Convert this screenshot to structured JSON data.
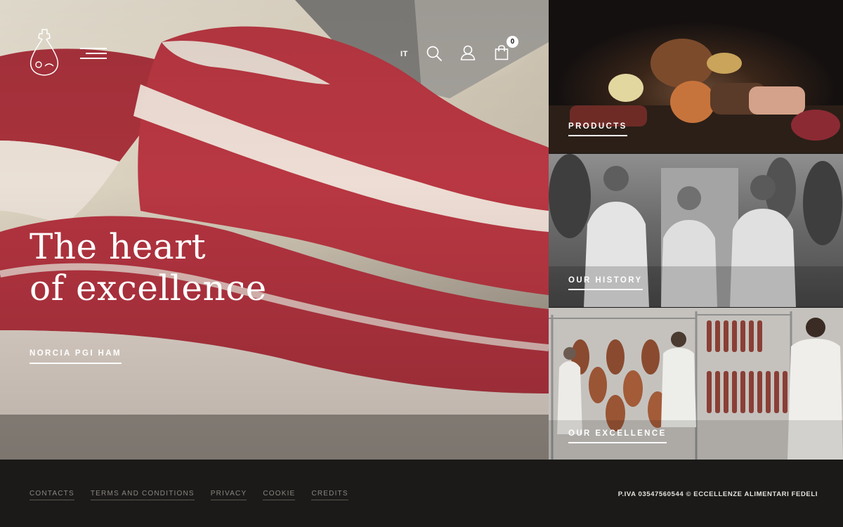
{
  "header": {
    "logo_icon": "ham-leg-icon",
    "menu_icon": "menu-icon",
    "language": "IT",
    "search_icon": "search-icon",
    "account_icon": "user-icon",
    "cart_icon": "shopping-bag-icon",
    "cart_count": "0"
  },
  "hero": {
    "title_line1": "The heart",
    "title_line2": "of excellence",
    "link_label": "NORCIA PGI HAM"
  },
  "panels": [
    {
      "label": "PRODUCTS"
    },
    {
      "label": "OUR HISTORY"
    },
    {
      "label": "OUR EXCELLENCE"
    }
  ],
  "footer": {
    "links": [
      "CONTACTS",
      "TERMS AND CONDITIONS",
      "PRIVACY",
      "COOKIE",
      "CREDITS"
    ],
    "copyright": "P.IVA 03547560544 © ECCELLENZE ALIMENTARI FEDELI"
  },
  "colors": {
    "footer_bg": "#1b1a19",
    "text_light": "#ffffff",
    "footer_link": "#8b8680",
    "ham_red": "#b8323f"
  }
}
